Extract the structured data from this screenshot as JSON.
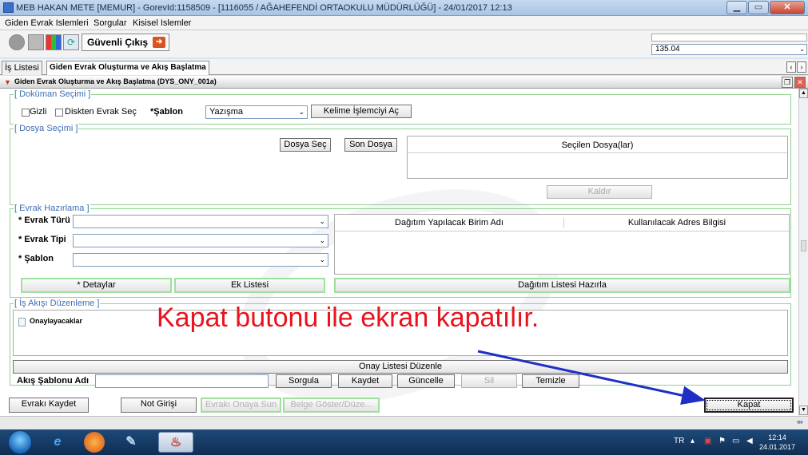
{
  "window": {
    "title": "MEB HAKAN METE [MEMUR] - GorevId:1158509 - [1116055 / AĞAHEFENDİ ORTAOKULU MÜDÜRLÜĞÜ] - 24/01/2017 12:13"
  },
  "menu": [
    "Giden Evrak Islemleri",
    "Sorgular",
    "Kisisel Islemler"
  ],
  "toolbar": {
    "guvenli_cikis": "Güvenli Çıkış",
    "version_value": "135.04"
  },
  "tabs": [
    "İş Listesi",
    "Giden Evrak Oluşturma ve Akış Başlatma"
  ],
  "form_title": "Giden Evrak Oluşturma ve Akış Başlatma (DYS_ONY_001a)",
  "dokuman": {
    "legend": "[ Doküman Seçimi ]",
    "gizli": "Gizli",
    "diskten": "Diskten Evrak Seç",
    "sablon_label": "*Şablon",
    "sablon_value": "Yazışma",
    "kelime_btn": "Kelime İşlemciyi Aç"
  },
  "dosya": {
    "legend": "[ Dosya Seçimi ]",
    "dosya_sec": "Dosya Seç",
    "son_dosya": "Son Dosya",
    "secilen_header": "Seçilen Dosya(lar)",
    "kaldir": "Kaldır"
  },
  "evrak": {
    "legend": "[ Evrak Hazırlama ]",
    "turu": "* Evrak Türü",
    "tipi": "* Evrak Tipi",
    "sablon": "* Şablon",
    "dagitim_header": "Dağıtım Yapılacak Birim Adı",
    "adres_header": "Kullanılacak Adres Bilgisi",
    "detaylar": "* Detaylar",
    "ek_listesi": "Ek Listesi",
    "dagitim_hazirla": "Dağıtım Listesi Hazırla"
  },
  "akis": {
    "legend": "[ İş Akışı Düzenleme ]",
    "onaylayacaklar": "Onaylayacaklar",
    "onay_listesi": "Onay Listesi Düzenle",
    "sablon_adi": "Akış Şablonu Adı",
    "sorgula": "Sorgula",
    "kaydet": "Kaydet",
    "guncelle": "Güncelle",
    "sil": "Sil",
    "temizle": "Temizle"
  },
  "bottom": {
    "evraki_kaydet": "Evrakı Kaydet",
    "not_girisi": "Not Girişi",
    "onaya_sun": "Evrakı Onaya Sun",
    "belge_goster": "Belge Göster/Düze...",
    "kapat": "Kapat"
  },
  "annotation": "Kapat butonu ile ekran kapatılır.",
  "taskbar": {
    "lang": "TR",
    "time": "12:14",
    "date": "24.01.2017"
  }
}
